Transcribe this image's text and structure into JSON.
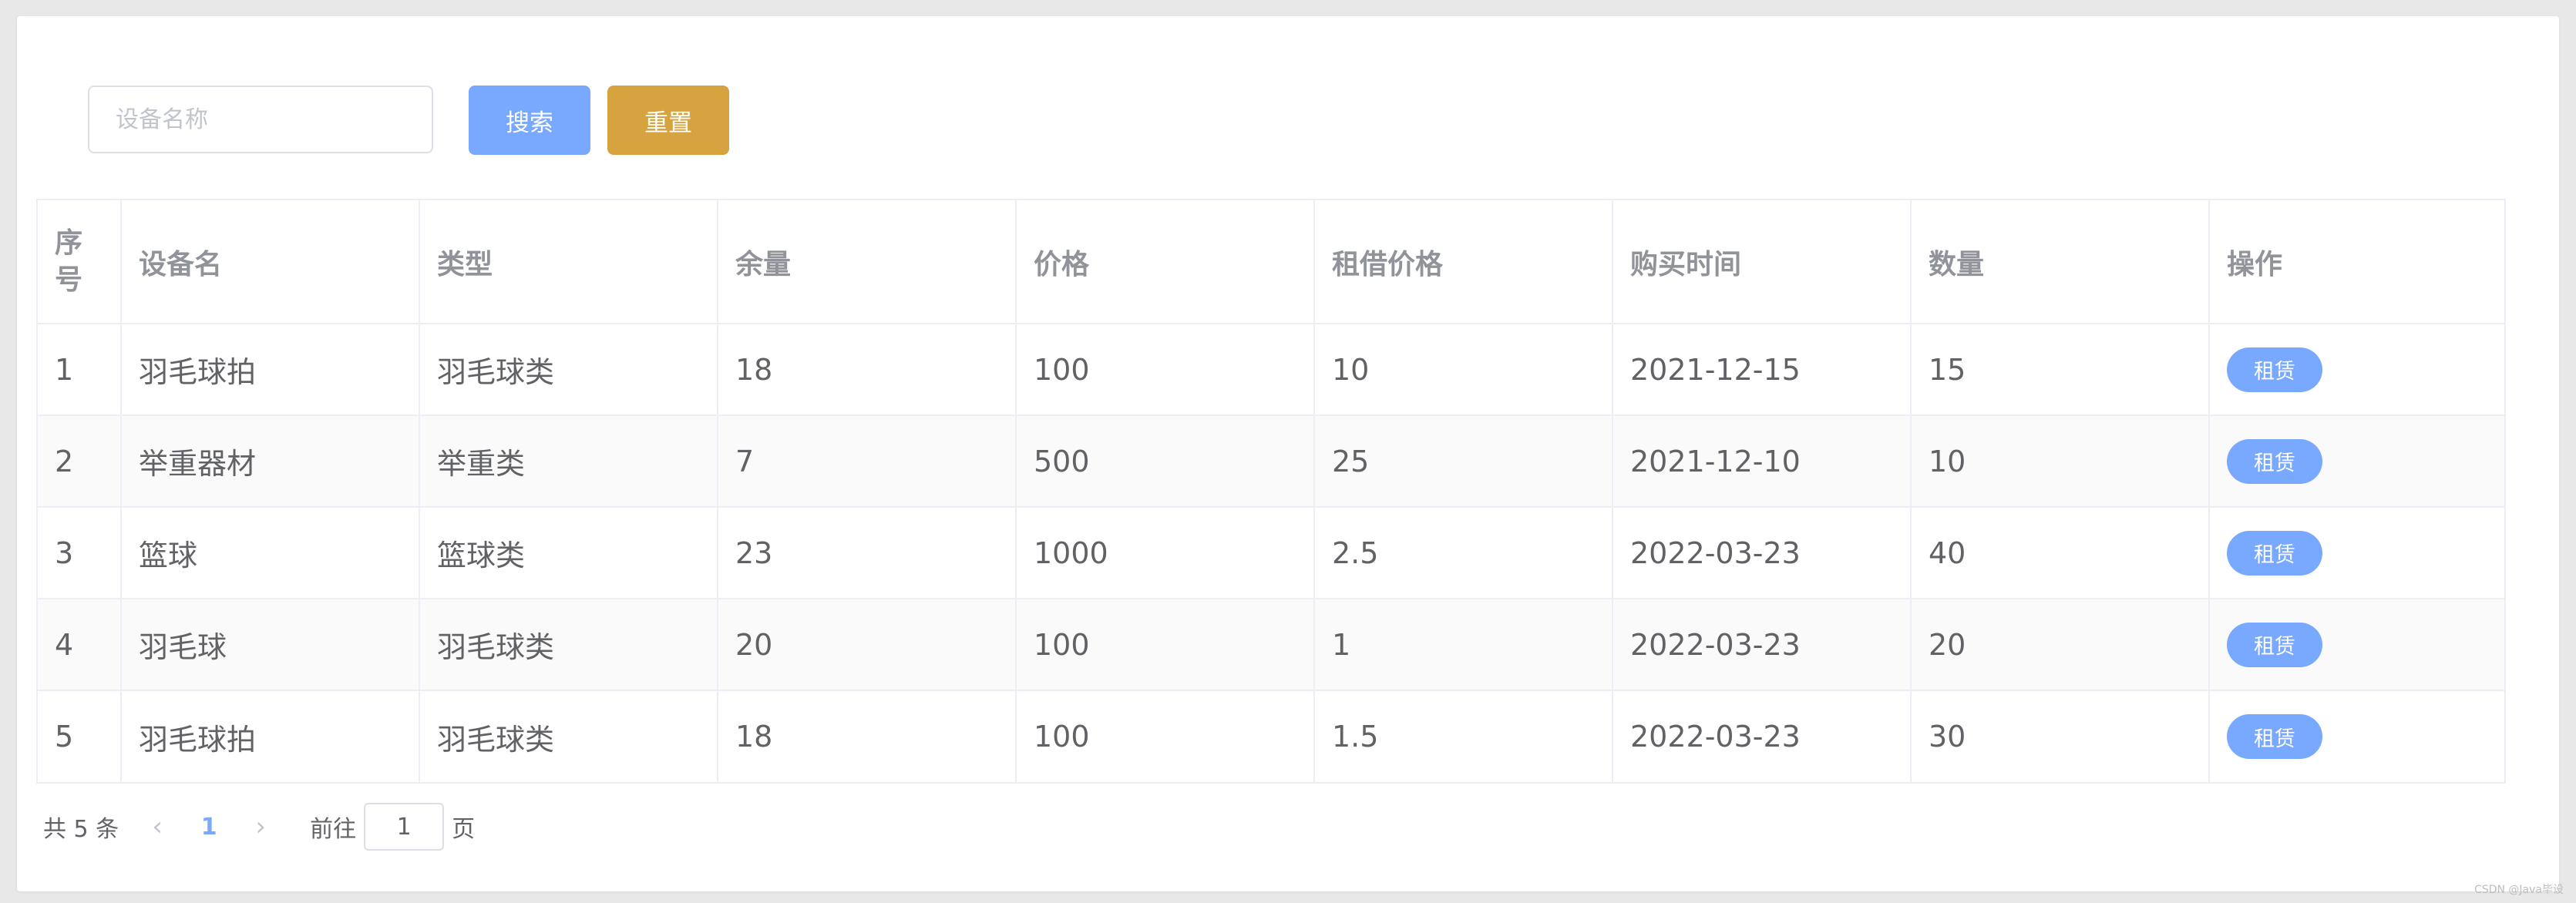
{
  "search": {
    "placeholder": "设备名称",
    "value": "",
    "search_label": "搜索",
    "reset_label": "重置"
  },
  "table": {
    "columns": [
      "序号",
      "设备名",
      "类型",
      "余量",
      "价格",
      "租借价格",
      "购买时间",
      "数量",
      "操作"
    ],
    "rows": [
      {
        "index": "1",
        "name": "羽毛球拍",
        "type": "羽毛球类",
        "remaining": "18",
        "price": "100",
        "rent_price": "10",
        "purchase_date": "2021-12-15",
        "quantity": "15",
        "action": "租赁"
      },
      {
        "index": "2",
        "name": "举重器材",
        "type": "举重类",
        "remaining": "7",
        "price": "500",
        "rent_price": "25",
        "purchase_date": "2021-12-10",
        "quantity": "10",
        "action": "租赁"
      },
      {
        "index": "3",
        "name": "篮球",
        "type": "篮球类",
        "remaining": "23",
        "price": "1000",
        "rent_price": "2.5",
        "purchase_date": "2022-03-23",
        "quantity": "40",
        "action": "租赁"
      },
      {
        "index": "4",
        "name": "羽毛球",
        "type": "羽毛球类",
        "remaining": "20",
        "price": "100",
        "rent_price": "1",
        "purchase_date": "2022-03-23",
        "quantity": "20",
        "action": "租赁"
      },
      {
        "index": "5",
        "name": "羽毛球拍",
        "type": "羽毛球类",
        "remaining": "18",
        "price": "100",
        "rent_price": "1.5",
        "purchase_date": "2022-03-23",
        "quantity": "30",
        "action": "租赁"
      }
    ]
  },
  "pagination": {
    "total_text": "共 5 条",
    "prev_icon": "‹",
    "next_icon": "›",
    "current_page": "1",
    "goto_prefix": "前往",
    "goto_value": "1",
    "goto_suffix": "页"
  },
  "watermark": "CSDN @Java毕设",
  "colors": {
    "primary": "#79a8ff",
    "warning": "#d6a33e",
    "header_text": "#909399",
    "body_text": "#606266"
  }
}
